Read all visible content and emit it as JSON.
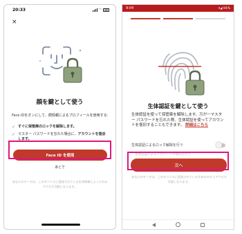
{
  "colors": {
    "accent": "#c0392b",
    "highlight": "#e0157f",
    "android_status_bar": "#b71c1c",
    "check_green": "#2e9e5b"
  },
  "ios": {
    "time": "20:33",
    "close_icon": "×",
    "title": "顔を鍵として使う",
    "description": "Face IDをオンにして、顔情報によるプロフィールを使用する:",
    "check_items": [
      {
        "icon": "✓",
        "bold": "すぐに保管庫のロックを解除します。",
        "text": ""
      },
      {
        "icon": "✓",
        "text": "マスター パスワードを忘れた場合に、",
        "bold": "アカウントを復旧します。"
      }
    ],
    "primary_button": "Face ID を使用",
    "later_link": "あとで",
    "footer": "あなたのデータは、このデバイスに登録されている生体情報によってのみアクセス可能になります。"
  },
  "android": {
    "time": "9:04",
    "status_right": "▾◢ 94%",
    "progress_steps": [
      true,
      true,
      false
    ],
    "title": "生体認証を鍵として使う",
    "description": "生体認証を使って保管庫を解除します。万が一マスター パスワードを忘れた際、生体認証を使ってアカウントを復旧することもできます。",
    "detail_link": "詳細はこちら",
    "toggle_label": "生体認証によるロック解除を行う",
    "toggle_on": false,
    "ghost_text": "生体認証によるアカウントの復旧を行う",
    "primary_button": "次へ",
    "footer": "あなたのデータは、このデバイスに登録されている生体のみからアクセス可能になります。"
  }
}
